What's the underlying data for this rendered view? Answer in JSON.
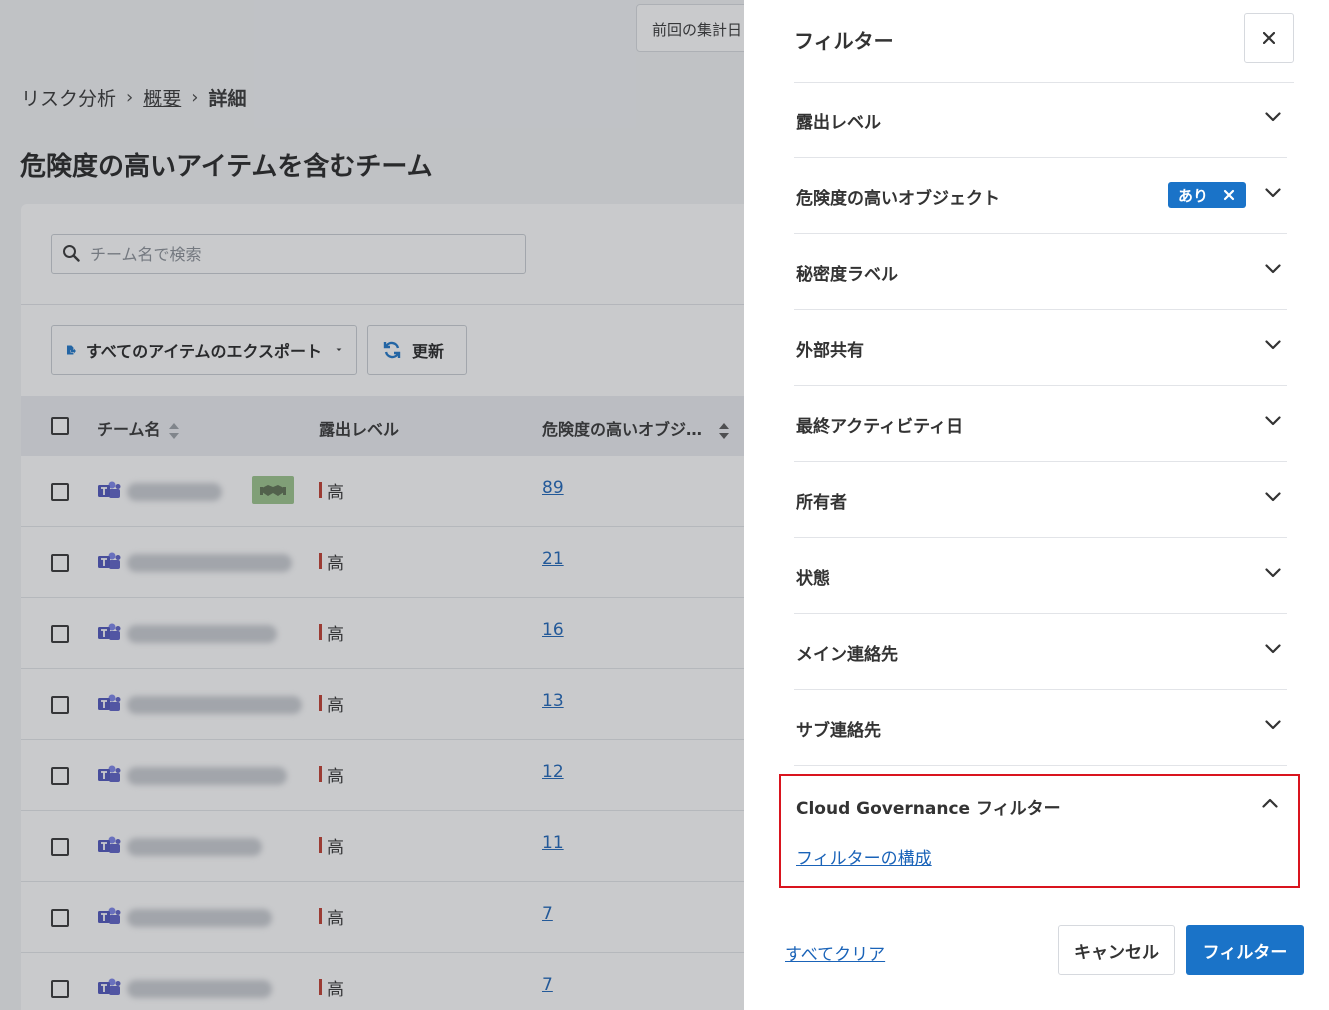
{
  "header": {
    "last_aggregation_label": "前回の集計日"
  },
  "breadcrumb": {
    "root": "リスク分析",
    "parent": "概要",
    "current": "詳細"
  },
  "page_title": "危険度の高いアイテムを含むチーム",
  "search": {
    "placeholder": "チーム名で検索",
    "value": ""
  },
  "toolbar": {
    "export_label": "すべてのアイテムのエクスポート",
    "refresh_label": "更新"
  },
  "table": {
    "columns": [
      "チーム名",
      "露出レベル",
      "危険度の高いオブジ…"
    ],
    "rows": [
      {
        "level": "高",
        "count": "89",
        "has_badge": true
      },
      {
        "level": "高",
        "count": "21",
        "has_badge": false
      },
      {
        "level": "高",
        "count": "16",
        "has_badge": false
      },
      {
        "level": "高",
        "count": "13",
        "has_badge": false
      },
      {
        "level": "高",
        "count": "12",
        "has_badge": false
      },
      {
        "level": "高",
        "count": "11",
        "has_badge": false
      },
      {
        "level": "高",
        "count": "7",
        "has_badge": false
      },
      {
        "level": "高",
        "count": "7",
        "has_badge": false
      }
    ]
  },
  "filter_panel": {
    "title": "フィルター",
    "items": [
      {
        "label": "露出レベル"
      },
      {
        "label": "危険度の高いオブジェクト",
        "chip": "あり"
      },
      {
        "label": "秘密度ラベル"
      },
      {
        "label": "外部共有"
      },
      {
        "label": "最終アクティビティ日"
      },
      {
        "label": "所有者"
      },
      {
        "label": "状態"
      },
      {
        "label": "メイン連絡先"
      },
      {
        "label": "サブ連絡先"
      }
    ],
    "cloud_governance": {
      "label": "Cloud Governance フィルター",
      "link": "フィルターの構成"
    },
    "clear_all": "すべてクリア",
    "cancel": "キャンセル",
    "apply": "フィルター"
  },
  "colors": {
    "accent": "#1a73c8",
    "link": "#1a63b8",
    "highlight_border": "#d9141e",
    "level_marker": "#c0392b",
    "teams_icon": "#5b5fc7"
  }
}
